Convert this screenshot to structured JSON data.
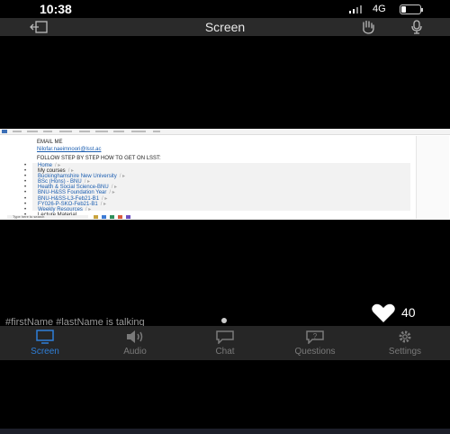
{
  "status_bar": {
    "time": "10:38",
    "network": "4G"
  },
  "top_bar": {
    "title": "Screen"
  },
  "shared_screen": {
    "email_label": "EMAIL ME",
    "email_address": "Nilofar.naeimnoori@lsst.ac",
    "instruction": "FOLLOW STEP BY STEP HOW TO GET ON LSST:",
    "steps": [
      {
        "text": "Home",
        "link": true
      },
      {
        "text": "My courses",
        "link": false
      },
      {
        "text": "Buckinghamshire New University",
        "link": true
      },
      {
        "text": "BSc (Hons) - BNU",
        "link": true
      },
      {
        "text": "Health & Social Science-BNU",
        "link": true
      },
      {
        "text": "BNU-H&SS Foundation Year",
        "link": true
      },
      {
        "text": "BNU-H&SS-L3-Feb21-B1",
        "link": true
      },
      {
        "text": "FY026-P-SKO-Feb21-B1",
        "link": true
      },
      {
        "text": "Weekly Resources",
        "link": true
      },
      {
        "text": "Lecture Material",
        "link": false
      }
    ],
    "crumb_separator": "/ ▸",
    "taskbar_search": "Type here to search"
  },
  "overlay": {
    "talking_text": "#firstName #lastName is talking",
    "like_count": "40"
  },
  "tabs": [
    {
      "label": "Screen",
      "icon": "screen-icon",
      "active": true
    },
    {
      "label": "Audio",
      "icon": "audio-icon",
      "active": false
    },
    {
      "label": "Chat",
      "icon": "chat-icon",
      "active": false
    },
    {
      "label": "Questions",
      "icon": "question-icon",
      "active": false
    },
    {
      "label": "Settings",
      "icon": "settings-icon",
      "active": false
    }
  ],
  "colors": {
    "accent": "#2f7fd8",
    "link": "#1a5db0",
    "tab_inactive": "#7a7a7a"
  }
}
